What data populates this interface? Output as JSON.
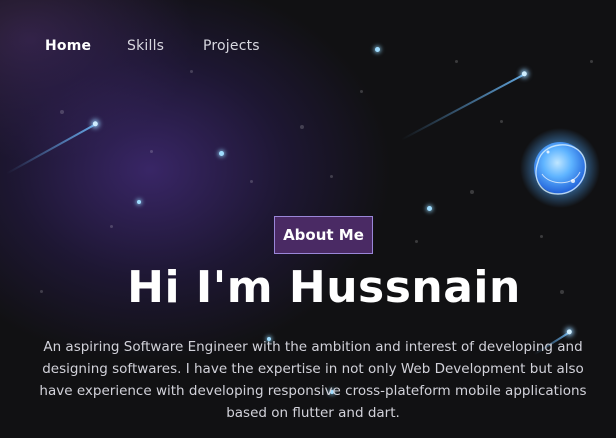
{
  "nav": {
    "items": [
      {
        "label": "Home",
        "active": true
      },
      {
        "label": "Skills",
        "active": false
      },
      {
        "label": "Projects",
        "active": false
      }
    ]
  },
  "hero": {
    "button_label": "About Me",
    "title": "Hi I'm Hussnain",
    "description": "An aspiring Software Engineer with the ambition and interest of developing and designing softwares. I have the expertise in not only Web Development but also have experience with developing responsive cross-plateform mobile applications based on flutter and dart."
  },
  "decor": {
    "background_icon": "starfield-background",
    "orb_icon": "glowing-planet-icon",
    "streak_icon": "shooting-star-icon"
  },
  "colors": {
    "background": "#121214",
    "nebula": "#462d82",
    "button_bg": "#4a2a64",
    "button_border": "#9a86d8",
    "star": "#9fdcff",
    "orb": "#4aa8ff"
  }
}
